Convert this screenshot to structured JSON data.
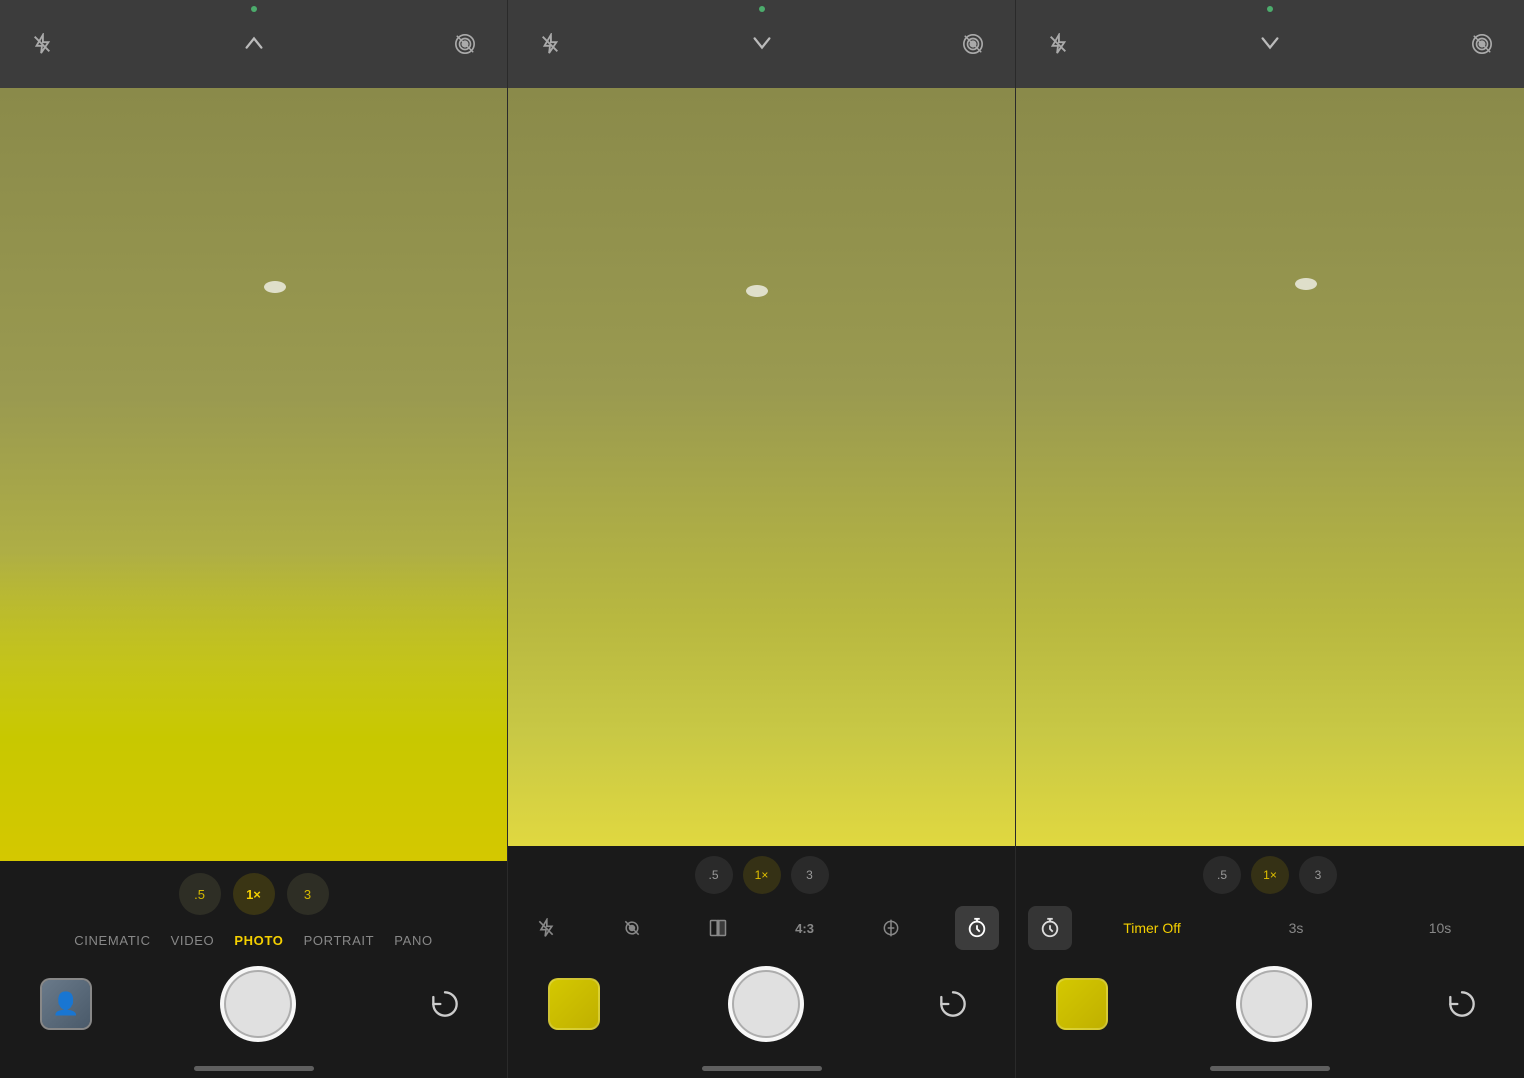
{
  "panels": [
    {
      "id": "panel1",
      "top_bar": {
        "left_icon": "flash-off-icon",
        "left_symbol": "⊗",
        "center_icon": "chevron-up-icon",
        "center_symbol": "∧",
        "right_icon": "live-photo-icon",
        "right_symbol": "⊙"
      },
      "zoom_buttons": [
        {
          "label": ".5",
          "active": false
        },
        {
          "label": "1×",
          "active": true
        },
        {
          "label": "3",
          "active": false
        }
      ],
      "modes": [
        {
          "label": "CINEMATIC",
          "active": false
        },
        {
          "label": "VIDEO",
          "active": false
        },
        {
          "label": "PHOTO",
          "active": true
        },
        {
          "label": "PORTRAIT",
          "active": false
        },
        {
          "label": "PANO",
          "active": false
        }
      ]
    },
    {
      "id": "panel2",
      "top_bar": {
        "left_icon": "flash-off-icon",
        "left_symbol": "⊗",
        "center_icon": "chevron-down-icon",
        "center_symbol": "∨",
        "right_icon": "live-photo-icon",
        "right_symbol": "⊙"
      },
      "zoom_buttons": [
        {
          "label": ".5",
          "active": false
        },
        {
          "label": "1×",
          "active": true
        },
        {
          "label": "3",
          "active": false
        }
      ],
      "tools": [
        {
          "name": "flash-tool",
          "symbol": "⚡",
          "active": false
        },
        {
          "name": "live-tool",
          "symbol": "⊙",
          "active": false
        },
        {
          "name": "flip-tool",
          "symbol": "⟳",
          "active": false
        },
        {
          "name": "ratio-tool",
          "label": "4:3",
          "active": false
        },
        {
          "name": "exposure-tool",
          "symbol": "⊕",
          "active": false
        },
        {
          "name": "timer-tool",
          "symbol": "⏱",
          "active": true
        }
      ]
    },
    {
      "id": "panel3",
      "top_bar": {
        "left_icon": "flash-off-icon",
        "left_symbol": "⊗",
        "center_icon": "chevron-down-icon",
        "center_symbol": "∨",
        "right_icon": "live-photo-icon",
        "right_symbol": "⊙"
      },
      "zoom_buttons": [
        {
          "label": ".5",
          "active": false
        },
        {
          "label": "1×",
          "active": true
        },
        {
          "label": "3",
          "active": false
        }
      ],
      "timer_options": [
        {
          "label": "Timer Off",
          "active": true
        },
        {
          "label": "3s",
          "active": false
        },
        {
          "label": "10s",
          "active": false
        }
      ]
    }
  ]
}
